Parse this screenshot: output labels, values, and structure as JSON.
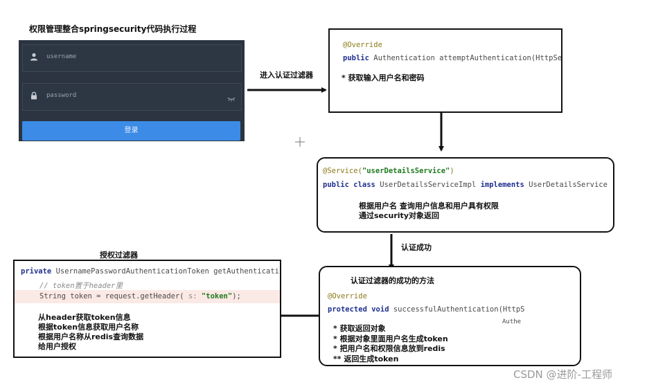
{
  "page_title": "权限管理整合springsecurity代码执行过程",
  "login": {
    "username_placeholder": "username",
    "password_placeholder": "password",
    "login_button": "登录"
  },
  "arrows": {
    "enter_auth_filter": "进入认证过滤器",
    "auth_success": "认证成功"
  },
  "box_attempt": {
    "annotation": "@Override",
    "keyword_public": "public",
    "signature": " Authentication attemptAuthentication(HttpSe",
    "bullet": "* 获取输入用户名和密码"
  },
  "box_service": {
    "annotation_prefix": "@Service(",
    "annotation_value": "\"userDetailsService\"",
    "annotation_suffix": ")",
    "kw_public": "public",
    "kw_class": "class",
    "class_name": " UserDetailsServiceImpl ",
    "kw_implements": "implements",
    "iface": " UserDetailsService",
    "note1": "根据用户名 查询用户信息和用户具有权限",
    "note2": "通过security对象返回"
  },
  "box_success": {
    "heading": "认证过滤器的成功的方法",
    "annotation": "@Override",
    "kw_protected": "protected",
    "kw_void": "void",
    "signature": " successfulAuthentication(HttpS",
    "continuation": "Authe",
    "bullets": [
      "* 获取返回对象",
      "* 根据对象里面用户名生成token",
      "* 把用户名和权限信息放到redis",
      "** 返回生成token"
    ]
  },
  "box_authz": {
    "heading": "授权过滤器",
    "kw_private": "private",
    "signature": " UsernamePasswordAuthenticationToken getAuthenticati",
    "comment": "// token置于header里",
    "code_prefix": "String token = request.getHeader(",
    "param_hint": " s: ",
    "code_string": "\"token\"",
    "code_suffix": ");",
    "notes": [
      "从header获取token信息",
      "根据token信息获取用户名称",
      "根据用户名称从redis查询数据",
      "给用户授权"
    ]
  },
  "watermark": "CSDN @进阶-工程师"
}
